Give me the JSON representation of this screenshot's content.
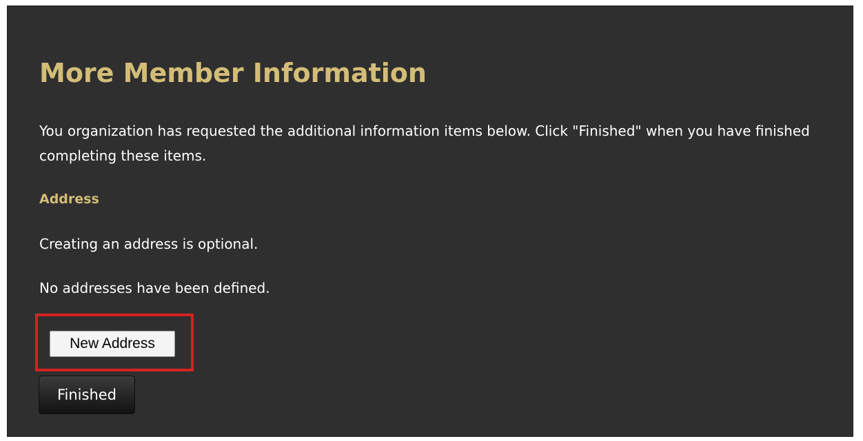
{
  "page": {
    "title": "More Member Information",
    "intro": "You organization has requested the additional information items below. Click \"Finished\" when you have finished completing these items."
  },
  "address_section": {
    "heading": "Address",
    "optional_note": "Creating an address is optional.",
    "empty_message": "No addresses have been defined.",
    "new_address_label": "New Address"
  },
  "actions": {
    "finished_label": "Finished"
  },
  "colors": {
    "panel_background": "#2f2f2f",
    "heading_gold": "#d3bd77",
    "highlight_red": "#d62222"
  }
}
